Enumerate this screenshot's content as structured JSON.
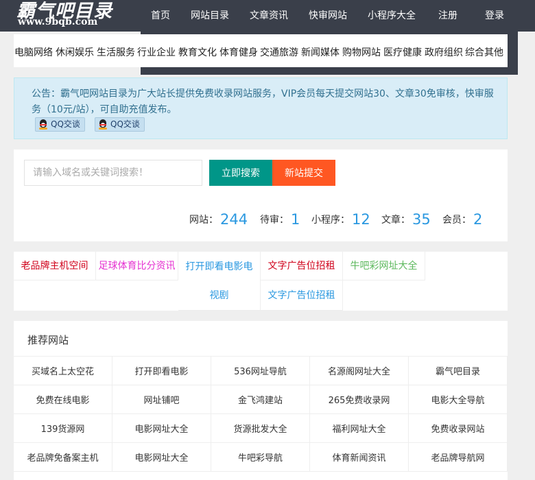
{
  "header": {
    "logo_title": "霸气吧目录",
    "logo_url": "www.9bqb.com",
    "nav": [
      "首页",
      "网站目录",
      "文章资讯",
      "快审网站",
      "小程序大全",
      "注册",
      "登录"
    ]
  },
  "categories": [
    "电脑网络",
    "休闲娱乐",
    "生活服务",
    "行业企业",
    "教育文化",
    "体育健身",
    "交通旅游",
    "新闻媒体",
    "购物网站",
    "医疗健康",
    "政府组织",
    "综合其他"
  ],
  "notice": {
    "text": "公告：霸气吧网站目录为广大站长提供免费收录网站服务，VIP会员每天提交网站30、文章30免审核，快审服务（10元/站），可自助充值发布。",
    "qq_buttons": [
      "QQ交谈",
      "QQ交谈"
    ]
  },
  "search": {
    "placeholder": "请输入域名或关键词搜索！",
    "search_label": "立即搜索",
    "submit_label": "新站提交"
  },
  "stats": [
    {
      "label": "网站：",
      "value": "244"
    },
    {
      "label": "待审：",
      "value": "1"
    },
    {
      "label": "小程序：",
      "value": "12"
    },
    {
      "label": "文章：",
      "value": "35"
    },
    {
      "label": "会员：",
      "value": "2"
    }
  ],
  "ads": [
    {
      "text": "老品牌主机空间",
      "color": "#d0021b"
    },
    {
      "text": "足球体育比分资讯",
      "color": "#e52fd0"
    },
    {
      "text": "打开即看电影电视剧",
      "color": "#2a98e0"
    },
    {
      "text": "文字广告位招租",
      "color": "#d0021b"
    },
    {
      "text": "牛吧彩网址大全",
      "color": "#5cb85c"
    },
    {
      "text": "文字广告位招租",
      "color": "#2a98e0"
    }
  ],
  "recommended": {
    "title": "推荐网站",
    "items": [
      "买域名上太空花",
      "打开即看电影",
      "536网址导航",
      "名源阁网址大全",
      "霸气吧目录",
      "免费在线电影",
      "网址铺吧",
      "金飞鸿建站",
      "265免费收录网",
      "电影大全导航",
      "139货源网",
      "电影网址大全",
      "货源批发大全",
      "福利网址大全",
      "免费收录网站",
      "老品牌免备案主机",
      "电影网址大全",
      "牛吧彩导航",
      "体育新闻资讯",
      "老品牌导航网"
    ]
  }
}
